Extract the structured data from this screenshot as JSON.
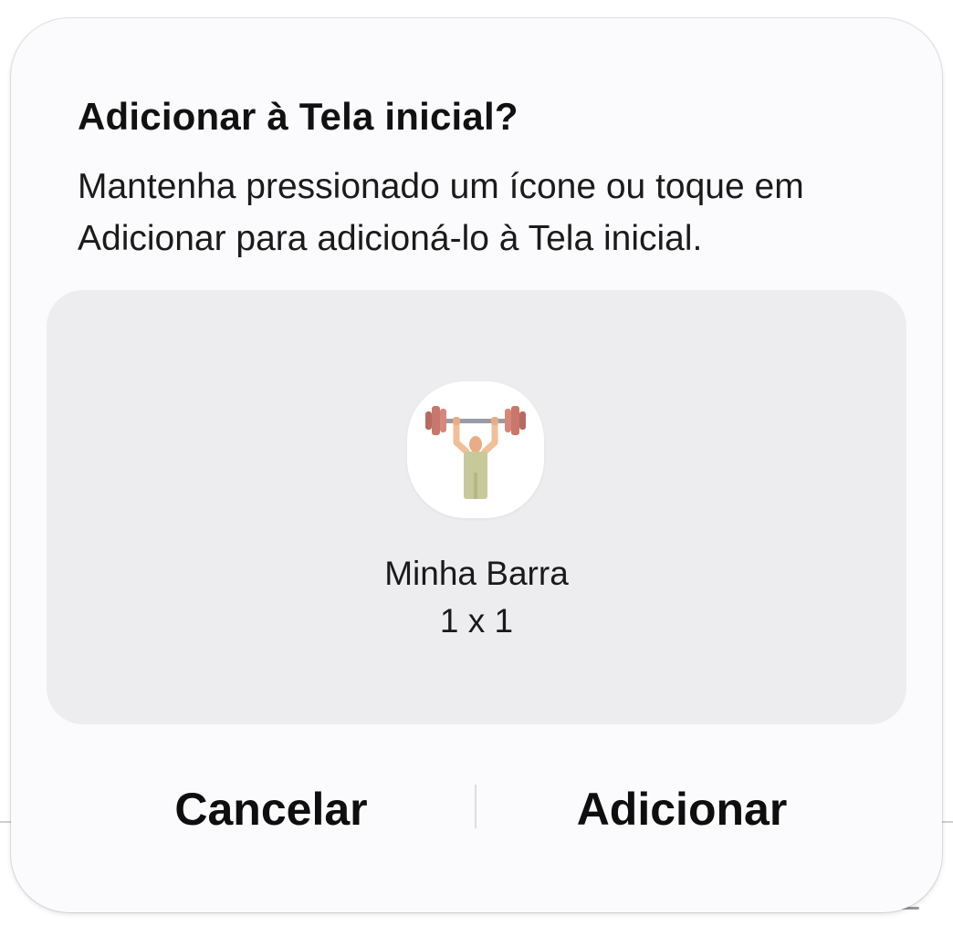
{
  "dialog": {
    "title": "Adicionar à Tela inicial?",
    "description": "Mantenha pressionado um ícone ou toque em Adicionar para adicioná-lo à Tela inicial."
  },
  "widget": {
    "icon": "weightlifter-icon",
    "name": "Minha Barra",
    "size": "1 x 1"
  },
  "buttons": {
    "cancel_label": "Cancelar",
    "add_label": "Adicionar"
  },
  "colors": {
    "dialog_bg": "#fbfbfd",
    "preview_bg": "#ededef",
    "text": "#111111"
  }
}
